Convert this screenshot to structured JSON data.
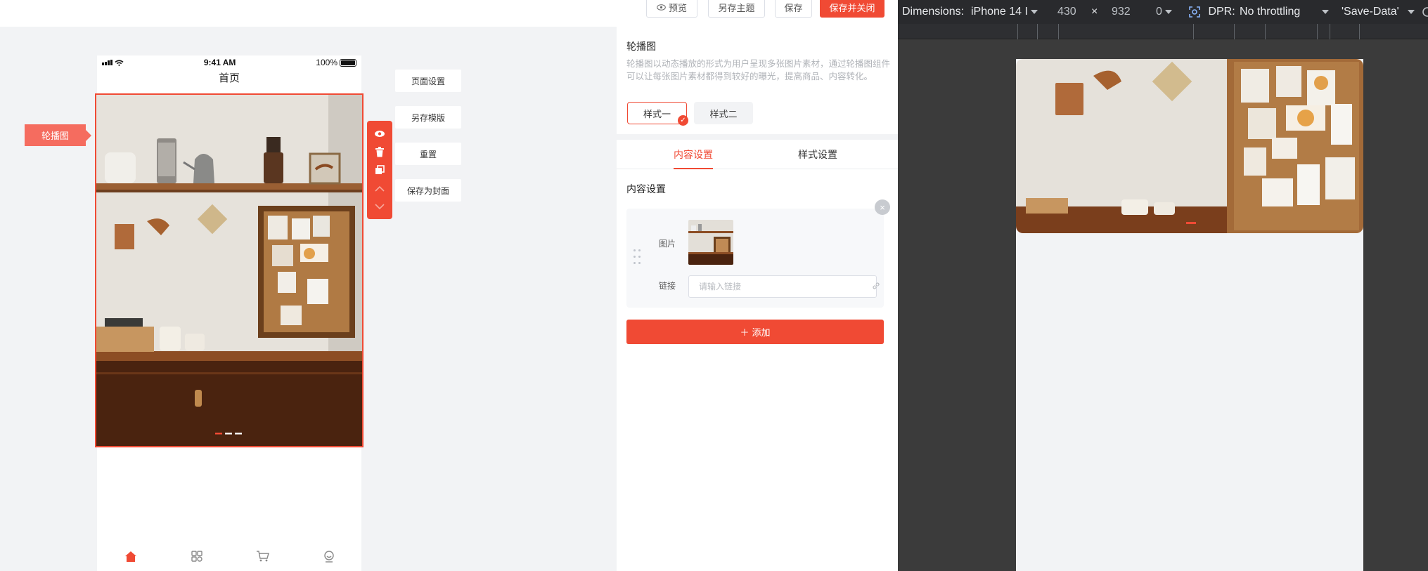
{
  "toolbar": {
    "preview_label": "预览",
    "save_theme_label": "另存主题",
    "save_label": "保存",
    "save_close_label": "保存并关闭"
  },
  "phone": {
    "status_time": "9:41 AM",
    "battery_text": "100%",
    "nav_title": "首页",
    "component_tag": "轮播图",
    "tabbar_icons": [
      "home-icon",
      "grid-icon",
      "cart-icon",
      "profile-icon"
    ]
  },
  "side_actions": {
    "page_settings": "页面设置",
    "save_template": "另存模版",
    "reset": "重置",
    "save_as_cover": "保存为封面"
  },
  "tool_icons": [
    "eye-icon",
    "trash-icon",
    "copy-icon",
    "arrow-up-icon",
    "arrow-down-icon"
  ],
  "panel": {
    "title": "轮播图",
    "description": "轮播图以动态播放的形式为用户呈现多张图片素材，通过轮播图组件可以让每张图片素材都得到较好的曝光，提高商品、内容转化。",
    "style_one": "样式一",
    "style_two": "样式二",
    "tab_content": "内容设置",
    "tab_style": "样式设置",
    "section_title": "内容设置",
    "image_label": "图片",
    "link_label": "链接",
    "link_placeholder": "请输入链接",
    "link_value": "",
    "add_label": "添加"
  },
  "devtools": {
    "dimensions_label": "Dimensions:",
    "device": "iPhone 14 I",
    "width": "430",
    "times": "×",
    "height": "932",
    "zoom": "0",
    "dpr_label": "DPR:",
    "throttle": "No throttling",
    "save_data": "'Save-Data'"
  },
  "colors": {
    "accent": "#f04a34",
    "tag": "#f56c5f",
    "devtools_bg": "#292a2d"
  }
}
